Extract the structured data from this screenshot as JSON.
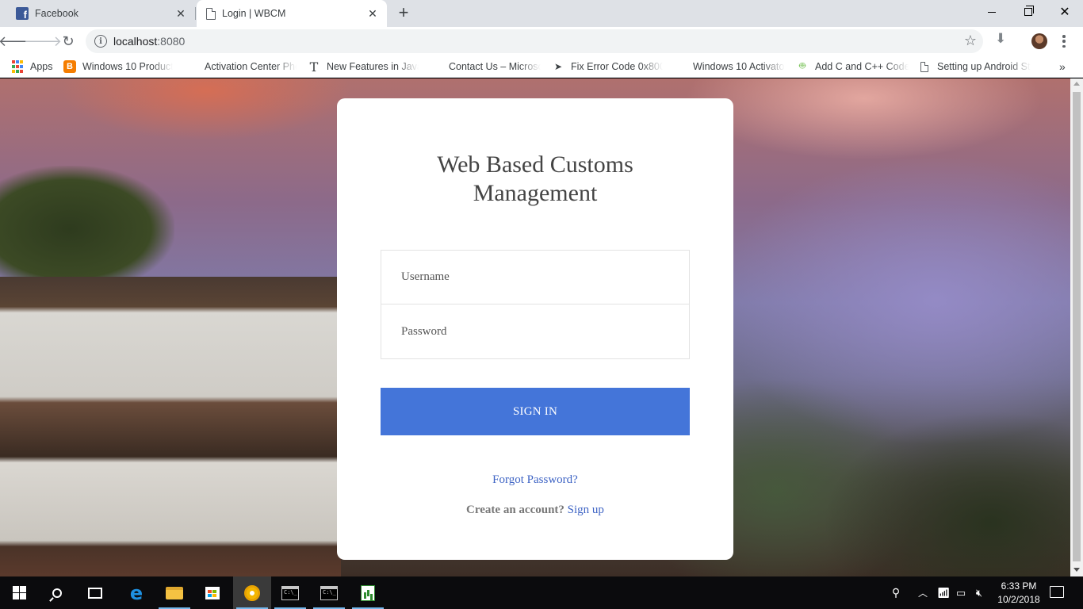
{
  "browser": {
    "tabs": [
      {
        "title": "Facebook",
        "icon": "facebook-icon",
        "active": false
      },
      {
        "title": "Login | WBCM",
        "icon": "page-icon",
        "active": true
      }
    ],
    "address": {
      "host": "localhost",
      "port": ":8080"
    },
    "bookmarks": [
      {
        "label": "Apps",
        "icon": "apps-grid-icon"
      },
      {
        "label": "Windows 10 Product",
        "icon": "blogger-icon"
      },
      {
        "label": "Activation Center Pho",
        "icon": "microsoft-icon"
      },
      {
        "label": "New Features in Java",
        "icon": "t-serif-icon"
      },
      {
        "label": "Contact Us – Microso",
        "icon": "microsoft-icon"
      },
      {
        "label": "Fix Error Code 0x800",
        "icon": "none"
      },
      {
        "label": "Windows 10 Activato",
        "icon": "none"
      },
      {
        "label": "Add C and C++ Code",
        "icon": "android-icon"
      },
      {
        "label": "Setting up Android St",
        "icon": "page-icon"
      }
    ]
  },
  "login": {
    "title": "Web Based Customs Management",
    "username_placeholder": "Username",
    "password_placeholder": "Password",
    "signin_label": "SIGN IN",
    "forgot_label": "Forgot Password?",
    "create_prompt": "Create an account?",
    "signup_label": "Sign up"
  },
  "taskbar": {
    "time": "6:33 PM",
    "date": "10/2/2018"
  },
  "colors": {
    "accent": "#4475d9",
    "link": "#3d63c4"
  }
}
